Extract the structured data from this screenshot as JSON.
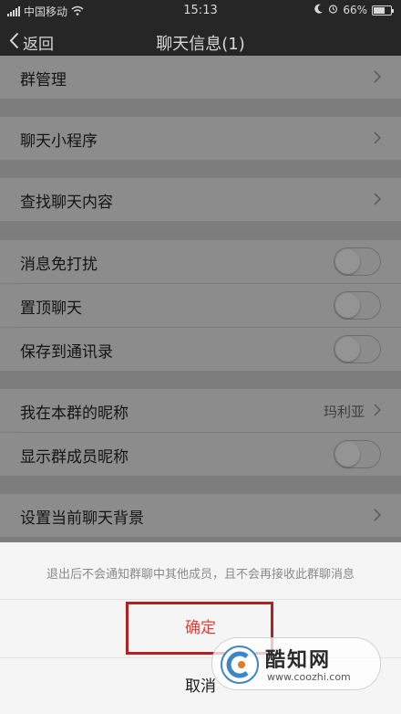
{
  "status_bar": {
    "carrier": "中国移动",
    "time": "15:13",
    "battery": "66%",
    "battery_level": 0.66
  },
  "nav": {
    "back_label": "返回",
    "title": "聊天信息(1)"
  },
  "settings": {
    "group_management": "群管理",
    "chat_mini_programs": "聊天小程序",
    "search_chat": "查找聊天内容",
    "mute": "消息免打扰",
    "pin": "置顶聊天",
    "save_contacts": "保存到通讯录",
    "my_alias": "我在本群的昵称",
    "my_alias_value": "玛利亚",
    "show_member_alias": "显示群成员昵称",
    "chat_background": "设置当前聊天背景"
  },
  "toggles": {
    "mute": false,
    "pin": false,
    "save_contacts": false,
    "show_member_alias": false
  },
  "sheet": {
    "message": "退出后不会通知群聊中其他成员，且不会再接收此群聊消息",
    "confirm": "确定",
    "cancel": "取消"
  },
  "watermark": {
    "name": "酷知网",
    "url": "www.coozhi.com"
  },
  "colors": {
    "confirm": "#e0403a",
    "highlight_box": "#b32020"
  }
}
